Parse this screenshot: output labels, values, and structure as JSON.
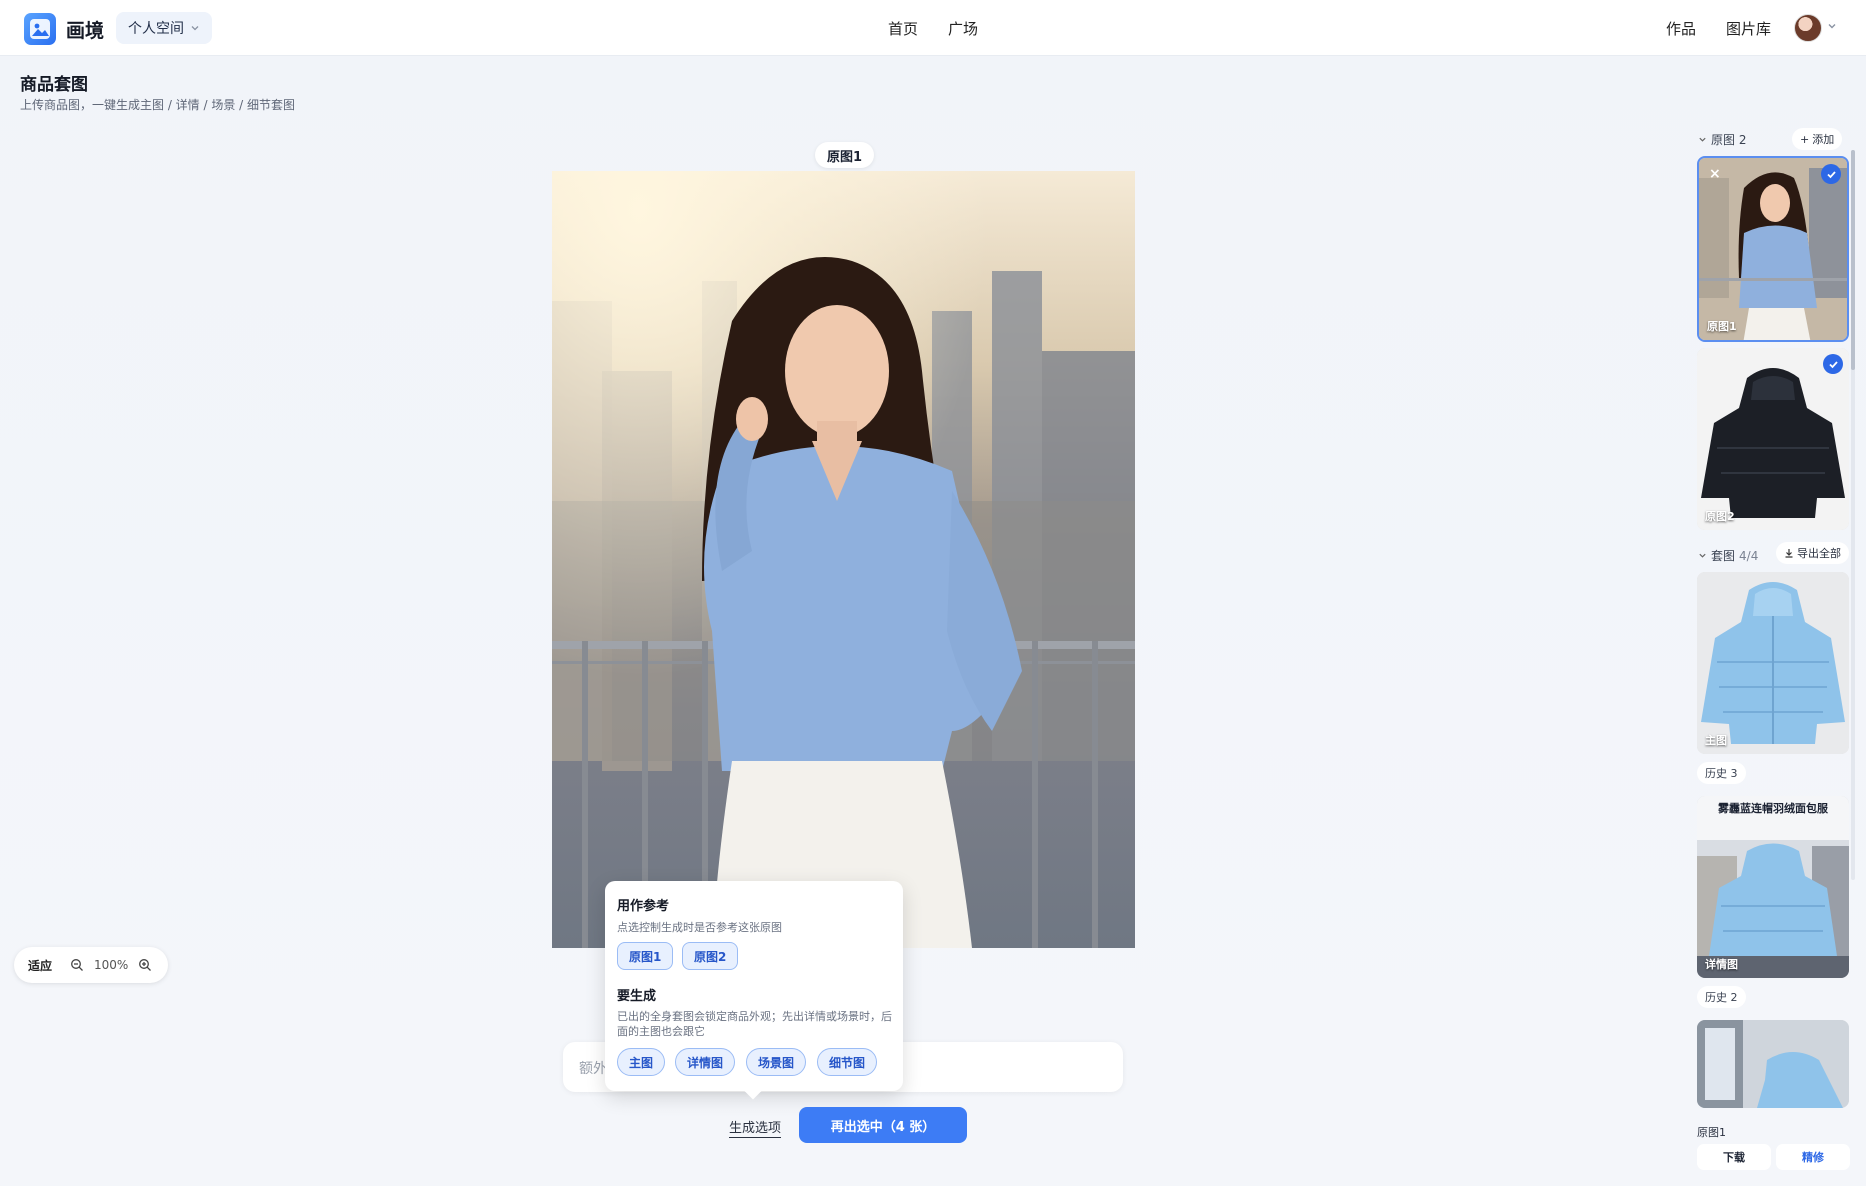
{
  "header": {
    "brand": "画境",
    "space": "个人空间",
    "nav": [
      "首页",
      "广场"
    ],
    "right": [
      "作品",
      "图片库"
    ]
  },
  "page": {
    "title": "商品套图",
    "subtitle": "上传商品图，一键生成主图 / 详情 / 场景 / 细节套图"
  },
  "canvas": {
    "label": "原图1"
  },
  "zoom": {
    "fit": "适应",
    "percent": "100%"
  },
  "prompt": {
    "placeholder": "额外"
  },
  "popover": {
    "ref_title": "用作参考",
    "ref_desc": "点选控制生成时是否参考这张原图",
    "ref_chips": [
      "原图1",
      "原图2"
    ],
    "gen_title": "要生成",
    "gen_desc": "已出的全身套图会锁定商品外观；先出详情或场景时，后面的主图也会跟它",
    "gen_chips": [
      "主图",
      "详情图",
      "场景图",
      "细节图"
    ]
  },
  "actions": {
    "options": "生成选项",
    "regenerate": "再出选中（4 张）"
  },
  "sidebar": {
    "originals_head": "原图 2",
    "add": "添加",
    "originals": [
      {
        "label": "原图1",
        "selected": true
      },
      {
        "label": "原图2",
        "selected": true
      }
    ],
    "set_head": "套图",
    "set_count": "4/4",
    "export_all": "导出全部",
    "set": [
      {
        "label": "主图",
        "history": "历史 3"
      },
      {
        "label": "详情图",
        "title": "雾霾蓝连帽羽绒面包服",
        "history": "历史 2"
      },
      {
        "label": "原图1"
      }
    ],
    "download": "下载",
    "refine": "精修"
  },
  "colors": {
    "accent": "#3d7cf5",
    "chip_bg": "#e8f0fe",
    "check": "#2d68e6"
  }
}
